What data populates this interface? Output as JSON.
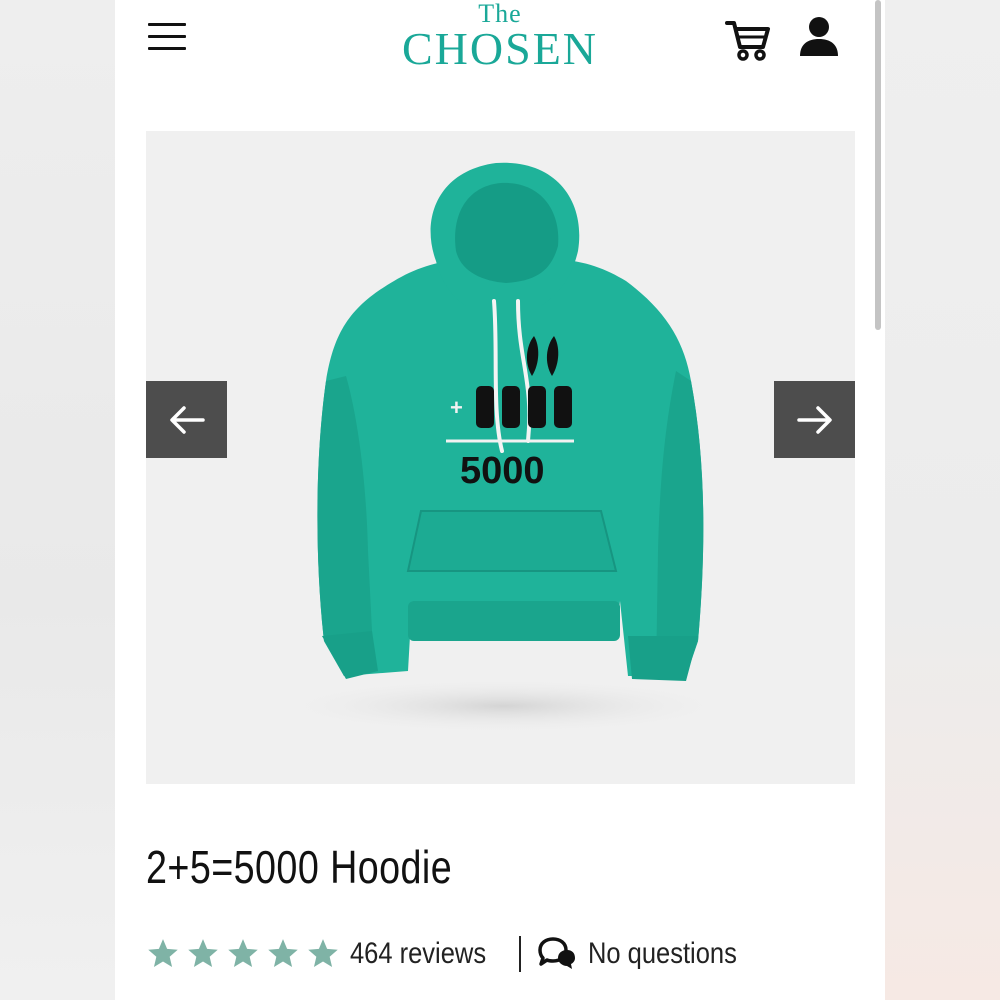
{
  "brand": {
    "logo_top": "The",
    "logo_main": "CHOSEN",
    "color": "#1aa898"
  },
  "header": {
    "menu_icon": "hamburger-menu-icon",
    "cart_icon": "shopping-cart-icon",
    "account_icon": "user-account-icon"
  },
  "gallery": {
    "prev_icon": "arrow-left-icon",
    "next_icon": "arrow-right-icon",
    "image": {
      "print_text": "5000",
      "print_plus": "+",
      "garment_color": "#1fb39a"
    }
  },
  "product": {
    "title": "2+5=5000 Hoodie",
    "rating_stars": 5,
    "star_color": "#7fb3a6",
    "reviews_text": "464 reviews",
    "questions_text": "No questions",
    "questions_icon": "speech-bubbles-icon"
  }
}
